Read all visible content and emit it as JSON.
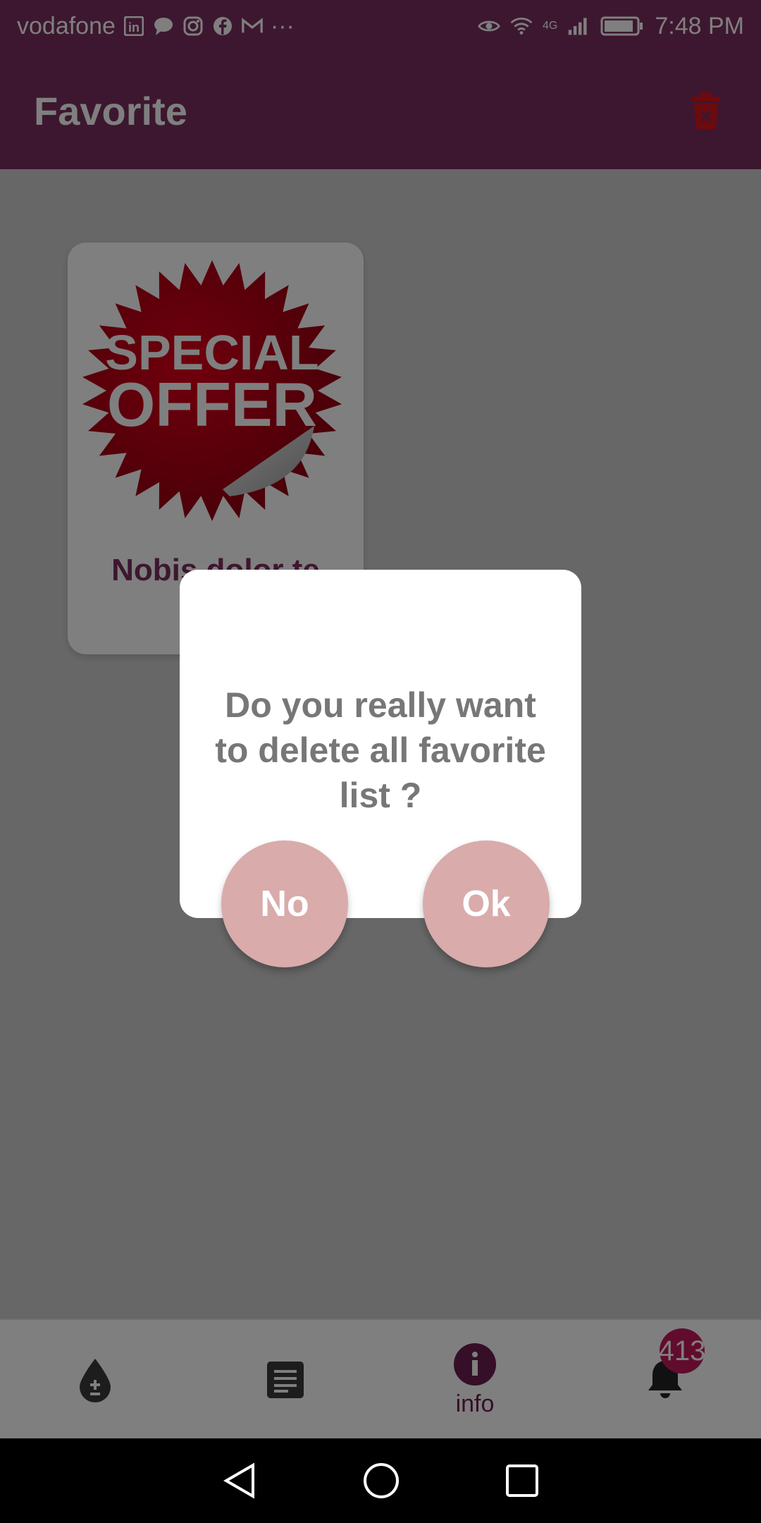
{
  "status_bar": {
    "carrier": "vodafone",
    "network_label": "4G",
    "time": "7:48 PM",
    "more": "···"
  },
  "app_bar": {
    "title": "Favorite",
    "color": "#7a2f5e"
  },
  "card": {
    "image_text_line1": "SPECIAL",
    "image_text_line2": "OFFER",
    "title": "Nobis dolor te"
  },
  "dialog": {
    "message": "Do you really want to delete all favorite list ?",
    "no_label": "No",
    "ok_label": "Ok"
  },
  "bottom_nav": {
    "items": [
      {
        "icon": "blood-drop-icon",
        "label": ""
      },
      {
        "icon": "article-icon",
        "label": ""
      },
      {
        "icon": "info-icon",
        "label": "info"
      },
      {
        "icon": "bell-icon",
        "label": ""
      }
    ],
    "notification_count": "413"
  }
}
